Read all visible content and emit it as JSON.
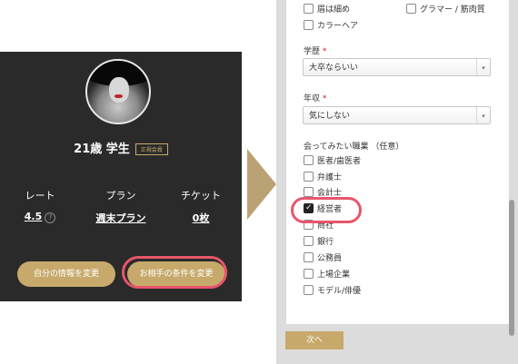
{
  "profile": {
    "name": "21歳 学生",
    "badge": "正規会員",
    "stats": [
      {
        "label": "レート",
        "value": "4.5",
        "help": "?"
      },
      {
        "label": "プラン",
        "value": "週末プラン"
      },
      {
        "label": "チケット",
        "value": "0枚"
      }
    ],
    "buttons": {
      "edit_self": "自分の情報を変更",
      "edit_partner": "お相手の条件を変更"
    }
  },
  "form": {
    "top_checkboxes": [
      {
        "label": "眉は細め",
        "checked": false
      },
      {
        "label": "グラマー / 筋肉質",
        "checked": false
      },
      {
        "label": "カラーヘア",
        "checked": false
      }
    ],
    "education": {
      "label": "学歴",
      "required": "*",
      "value": "大卒ならいい"
    },
    "income": {
      "label": "年収",
      "required": "*",
      "value": "気にしない"
    },
    "occupation": {
      "label": "会ってみたい職業 （任意）",
      "options": [
        {
          "label": "医者/歯医者",
          "checked": false
        },
        {
          "label": "弁護士",
          "checked": false
        },
        {
          "label": "会計士",
          "checked": false
        },
        {
          "label": "経営者",
          "checked": true
        },
        {
          "label": "商社",
          "checked": false
        },
        {
          "label": "銀行",
          "checked": false
        },
        {
          "label": "公務員",
          "checked": false
        },
        {
          "label": "上場企業",
          "checked": false
        },
        {
          "label": "モデル/俳優",
          "checked": false
        }
      ]
    },
    "next_button": "次へ"
  },
  "colors": {
    "accent_gold": "#c7a96b",
    "highlight_ring": "#e8556b",
    "card_dark": "#2a2a2a"
  }
}
